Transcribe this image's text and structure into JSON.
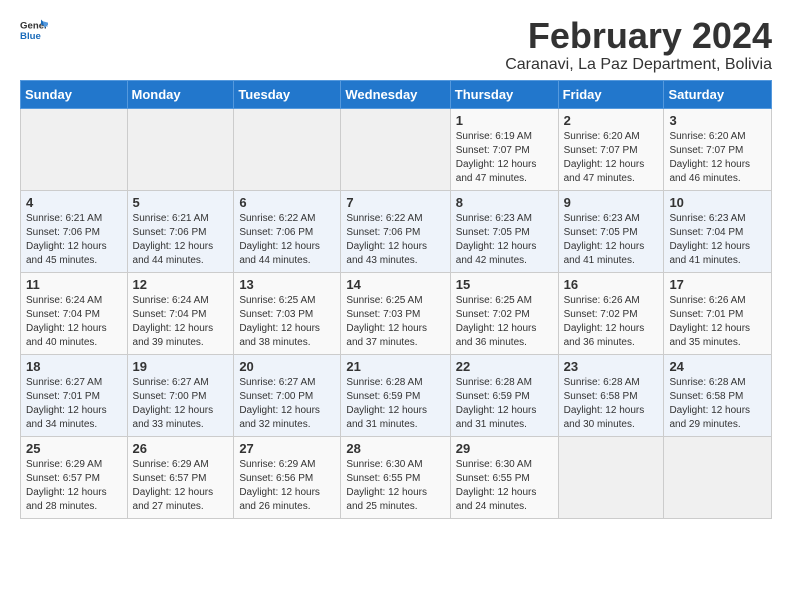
{
  "header": {
    "logo_general": "General",
    "logo_blue": "Blue",
    "title": "February 2024",
    "subtitle": "Caranavi, La Paz Department, Bolivia"
  },
  "weekdays": [
    "Sunday",
    "Monday",
    "Tuesday",
    "Wednesday",
    "Thursday",
    "Friday",
    "Saturday"
  ],
  "weeks": [
    [
      {
        "num": "",
        "info": ""
      },
      {
        "num": "",
        "info": ""
      },
      {
        "num": "",
        "info": ""
      },
      {
        "num": "",
        "info": ""
      },
      {
        "num": "1",
        "info": "Sunrise: 6:19 AM\nSunset: 7:07 PM\nDaylight: 12 hours and 47 minutes."
      },
      {
        "num": "2",
        "info": "Sunrise: 6:20 AM\nSunset: 7:07 PM\nDaylight: 12 hours and 47 minutes."
      },
      {
        "num": "3",
        "info": "Sunrise: 6:20 AM\nSunset: 7:07 PM\nDaylight: 12 hours and 46 minutes."
      }
    ],
    [
      {
        "num": "4",
        "info": "Sunrise: 6:21 AM\nSunset: 7:06 PM\nDaylight: 12 hours and 45 minutes."
      },
      {
        "num": "5",
        "info": "Sunrise: 6:21 AM\nSunset: 7:06 PM\nDaylight: 12 hours and 44 minutes."
      },
      {
        "num": "6",
        "info": "Sunrise: 6:22 AM\nSunset: 7:06 PM\nDaylight: 12 hours and 44 minutes."
      },
      {
        "num": "7",
        "info": "Sunrise: 6:22 AM\nSunset: 7:06 PM\nDaylight: 12 hours and 43 minutes."
      },
      {
        "num": "8",
        "info": "Sunrise: 6:23 AM\nSunset: 7:05 PM\nDaylight: 12 hours and 42 minutes."
      },
      {
        "num": "9",
        "info": "Sunrise: 6:23 AM\nSunset: 7:05 PM\nDaylight: 12 hours and 41 minutes."
      },
      {
        "num": "10",
        "info": "Sunrise: 6:23 AM\nSunset: 7:04 PM\nDaylight: 12 hours and 41 minutes."
      }
    ],
    [
      {
        "num": "11",
        "info": "Sunrise: 6:24 AM\nSunset: 7:04 PM\nDaylight: 12 hours and 40 minutes."
      },
      {
        "num": "12",
        "info": "Sunrise: 6:24 AM\nSunset: 7:04 PM\nDaylight: 12 hours and 39 minutes."
      },
      {
        "num": "13",
        "info": "Sunrise: 6:25 AM\nSunset: 7:03 PM\nDaylight: 12 hours and 38 minutes."
      },
      {
        "num": "14",
        "info": "Sunrise: 6:25 AM\nSunset: 7:03 PM\nDaylight: 12 hours and 37 minutes."
      },
      {
        "num": "15",
        "info": "Sunrise: 6:25 AM\nSunset: 7:02 PM\nDaylight: 12 hours and 36 minutes."
      },
      {
        "num": "16",
        "info": "Sunrise: 6:26 AM\nSunset: 7:02 PM\nDaylight: 12 hours and 36 minutes."
      },
      {
        "num": "17",
        "info": "Sunrise: 6:26 AM\nSunset: 7:01 PM\nDaylight: 12 hours and 35 minutes."
      }
    ],
    [
      {
        "num": "18",
        "info": "Sunrise: 6:27 AM\nSunset: 7:01 PM\nDaylight: 12 hours and 34 minutes."
      },
      {
        "num": "19",
        "info": "Sunrise: 6:27 AM\nSunset: 7:00 PM\nDaylight: 12 hours and 33 minutes."
      },
      {
        "num": "20",
        "info": "Sunrise: 6:27 AM\nSunset: 7:00 PM\nDaylight: 12 hours and 32 minutes."
      },
      {
        "num": "21",
        "info": "Sunrise: 6:28 AM\nSunset: 6:59 PM\nDaylight: 12 hours and 31 minutes."
      },
      {
        "num": "22",
        "info": "Sunrise: 6:28 AM\nSunset: 6:59 PM\nDaylight: 12 hours and 31 minutes."
      },
      {
        "num": "23",
        "info": "Sunrise: 6:28 AM\nSunset: 6:58 PM\nDaylight: 12 hours and 30 minutes."
      },
      {
        "num": "24",
        "info": "Sunrise: 6:28 AM\nSunset: 6:58 PM\nDaylight: 12 hours and 29 minutes."
      }
    ],
    [
      {
        "num": "25",
        "info": "Sunrise: 6:29 AM\nSunset: 6:57 PM\nDaylight: 12 hours and 28 minutes."
      },
      {
        "num": "26",
        "info": "Sunrise: 6:29 AM\nSunset: 6:57 PM\nDaylight: 12 hours and 27 minutes."
      },
      {
        "num": "27",
        "info": "Sunrise: 6:29 AM\nSunset: 6:56 PM\nDaylight: 12 hours and 26 minutes."
      },
      {
        "num": "28",
        "info": "Sunrise: 6:30 AM\nSunset: 6:55 PM\nDaylight: 12 hours and 25 minutes."
      },
      {
        "num": "29",
        "info": "Sunrise: 6:30 AM\nSunset: 6:55 PM\nDaylight: 12 hours and 24 minutes."
      },
      {
        "num": "",
        "info": ""
      },
      {
        "num": "",
        "info": ""
      }
    ]
  ]
}
